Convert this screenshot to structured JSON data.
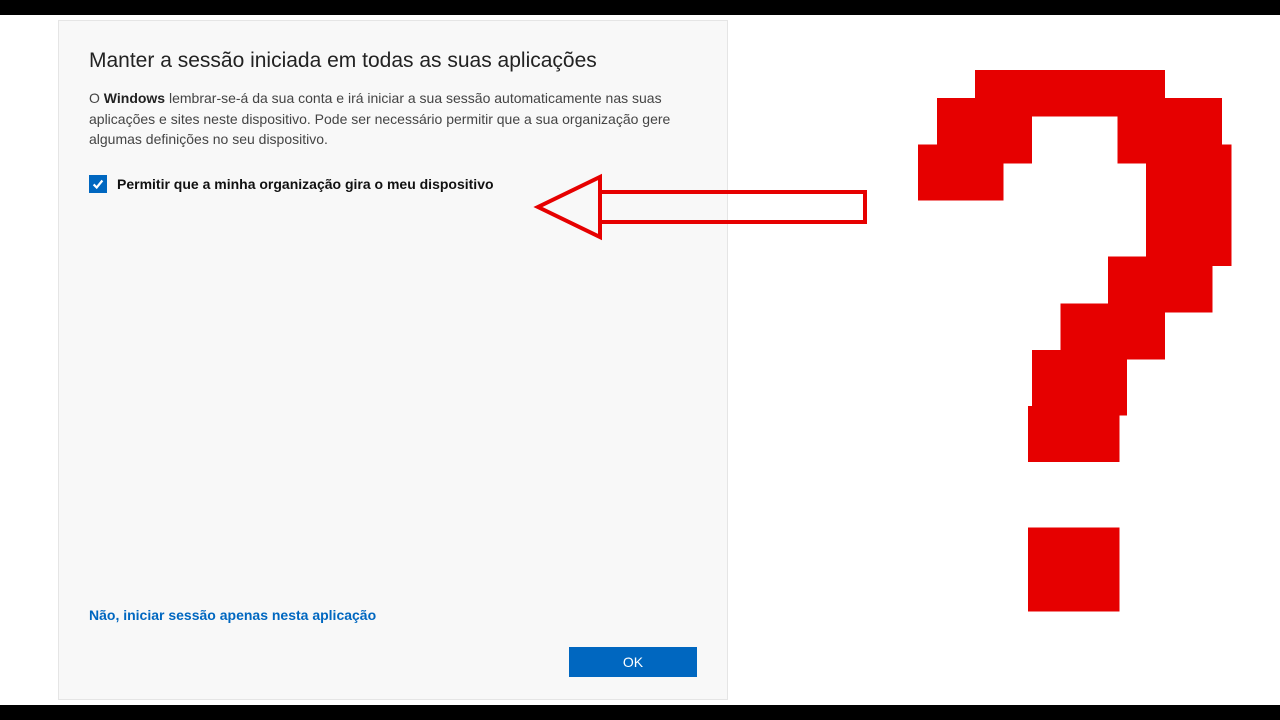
{
  "dialog": {
    "title": "Manter a sessão iniciada em todas as suas aplicações",
    "description_lead": "O ",
    "description_strong": "Windows",
    "description_rest": " lembrar-se-á da sua conta e irá iniciar a sua sessão automaticamente nas suas aplicações e sites neste dispositivo. Pode ser necessário permitir que a sua organização gere algumas definições no seu dispositivo.",
    "checkbox": {
      "checked": true,
      "label": "Permitir que a minha organização gira o meu dispositivo"
    },
    "link_label": "Não, iniciar sessão apenas nesta aplicação",
    "ok_label": "OK"
  },
  "annotation": {
    "arrow_color": "#e60000",
    "question_mark_color": "#e60000"
  }
}
